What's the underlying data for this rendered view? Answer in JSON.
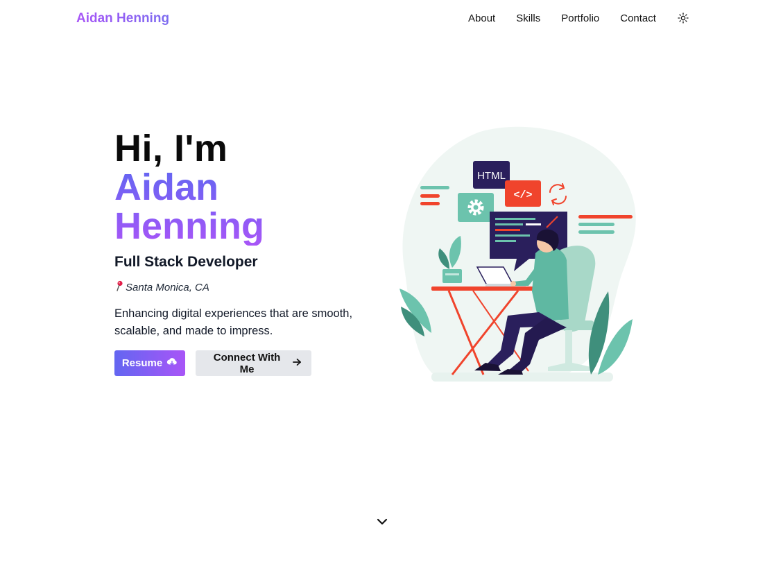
{
  "header": {
    "brand": "Aidan Henning",
    "nav": [
      "About",
      "Skills",
      "Portfolio",
      "Contact"
    ],
    "theme_toggle_icon": "sun-icon"
  },
  "hero": {
    "greeting": "Hi, I'm",
    "name": "Aidan Henning",
    "role": "Full Stack Developer",
    "location": "Santa Monica, CA",
    "location_icon": "pin-icon",
    "tagline": "Enhancing digital experiences that are smooth, scalable, and made to impress.",
    "resume_label": "Resume",
    "resume_icon": "cloud-download-icon",
    "connect_label": "Connect With Me",
    "connect_icon": "arrow-right-icon"
  },
  "illustration": {
    "html_label": "HTML",
    "code_label": "</>"
  },
  "scroll_icon": "chevron-down-icon",
  "colors": {
    "accent_start": "#6366f1",
    "accent_end": "#a855f7",
    "teal": "#5fb8a2",
    "coral": "#f0442c",
    "navy": "#2a1f5c"
  }
}
